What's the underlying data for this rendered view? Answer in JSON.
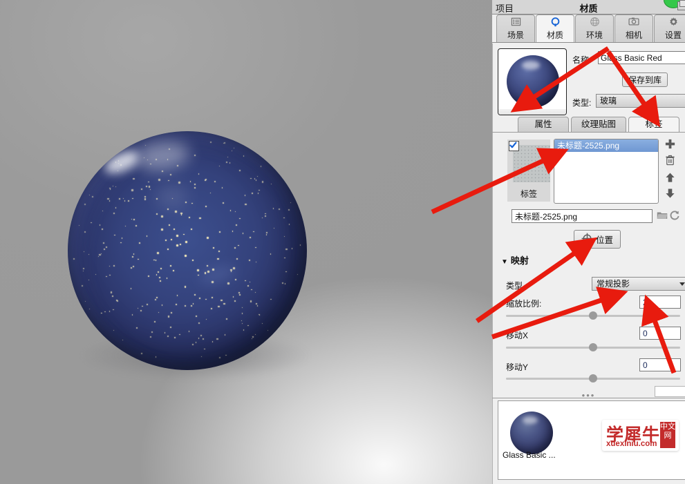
{
  "viewport": {
    "name": "3d-render-viewport",
    "object": "sphere-with-starfield-texture"
  },
  "panel": {
    "header": {
      "project_label": "项目",
      "title": "材质"
    },
    "tabs": [
      {
        "label": "场景",
        "icon": "list-icon",
        "active": false
      },
      {
        "label": "材质",
        "icon": "material-icon",
        "active": true
      },
      {
        "label": "环境",
        "icon": "globe-icon",
        "active": false
      },
      {
        "label": "相机",
        "icon": "camera-icon",
        "active": false
      },
      {
        "label": "设置",
        "icon": "gear-icon",
        "active": false
      }
    ],
    "material": {
      "name_label": "名称:",
      "name_value": "Glass Basic Red",
      "save_to_library": "保存到库",
      "type_label": "类型:",
      "type_value": "玻璃"
    },
    "subtabs": [
      {
        "label": "属性",
        "active": false
      },
      {
        "label": "纹理贴图",
        "active": false
      },
      {
        "label": "标签",
        "active": true
      }
    ],
    "texture": {
      "checkbox_checked": true,
      "slot_label": "标签",
      "list_items": [
        "未标题-2525.png"
      ],
      "selected_index": 0,
      "path_value": "未标题-2525.png",
      "side_buttons": [
        "add-icon",
        "trash-icon",
        "arrow-up-icon",
        "arrow-down-icon"
      ],
      "folder_icon": "folder-icon",
      "reload_icon": "reload-icon",
      "position_button": "位置",
      "position_icon": "crosshair-icon"
    },
    "mapping": {
      "section_title": "映射",
      "caret": "▼",
      "type_label": "类型",
      "projection_value": "常规投影",
      "rows": [
        {
          "label": "缩放比例:",
          "value": "2",
          "knob_pct": 50
        },
        {
          "label": "移动X",
          "value": "0",
          "knob_pct": 50
        },
        {
          "label": "移动Y",
          "value": "0",
          "knob_pct": 50
        }
      ],
      "splitter": "•••"
    },
    "library": {
      "items": [
        {
          "label": "Glass Basic ..."
        }
      ],
      "watermark": {
        "brand": "学犀牛",
        "url": "xuexiniu.com",
        "badge": "中文网"
      }
    }
  },
  "colors": {
    "panel_bg": "#efefef",
    "tab_active_accent": "#1663d6",
    "selection_blue": "#6f97d2",
    "annotation_red": "#e81b0e",
    "sphere_blue": "#2a3366",
    "watermark_red": "#c32b2b"
  }
}
